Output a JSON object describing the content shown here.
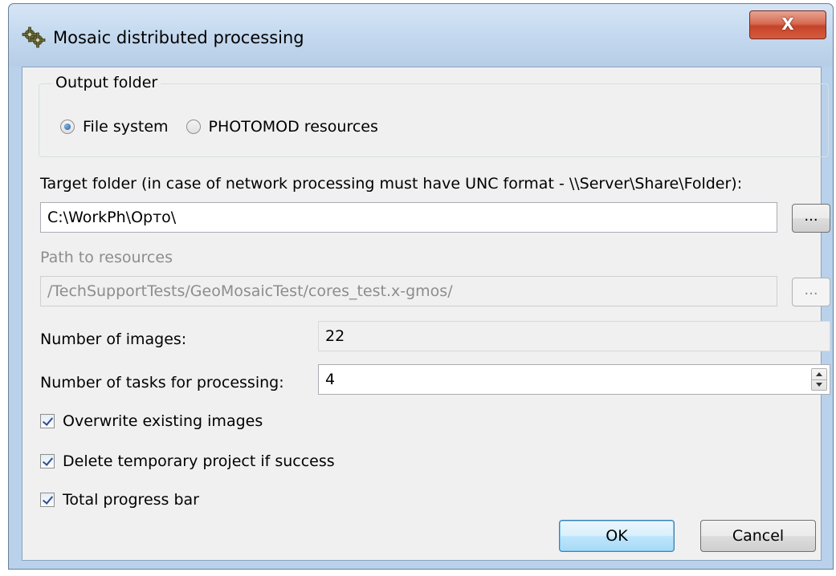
{
  "window": {
    "title": "Mosaic distributed processing",
    "close_label": "X"
  },
  "output_folder": {
    "group_title": "Output folder",
    "options": [
      {
        "label": "File system",
        "selected": true
      },
      {
        "label": "PHOTOMOD resources",
        "selected": false
      }
    ]
  },
  "target_folder": {
    "label": "Target folder (in case of network processing must have UNC format - \\\\Server\\Share\\Folder):",
    "value": "C:\\WorkPh\\Орто\\",
    "browse_label": "..."
  },
  "resources_path": {
    "label": "Path to resources",
    "value": "/TechSupportTests/GeoMosaicTest/cores_test.x-gmos/",
    "browse_label": "..."
  },
  "images": {
    "label": "Number of images:",
    "value": "22"
  },
  "tasks": {
    "label": "Number of tasks for processing:",
    "value": "4"
  },
  "checkboxes": [
    {
      "label": "Overwrite existing images",
      "checked": true
    },
    {
      "label": "Delete temporary project if success",
      "checked": true
    },
    {
      "label": "Total progress bar",
      "checked": true
    }
  ],
  "buttons": {
    "ok": "OK",
    "cancel": "Cancel"
  },
  "icons": {
    "app": "gear-icon",
    "close": "close-icon",
    "spinner": "spinner-arrows-icon"
  }
}
